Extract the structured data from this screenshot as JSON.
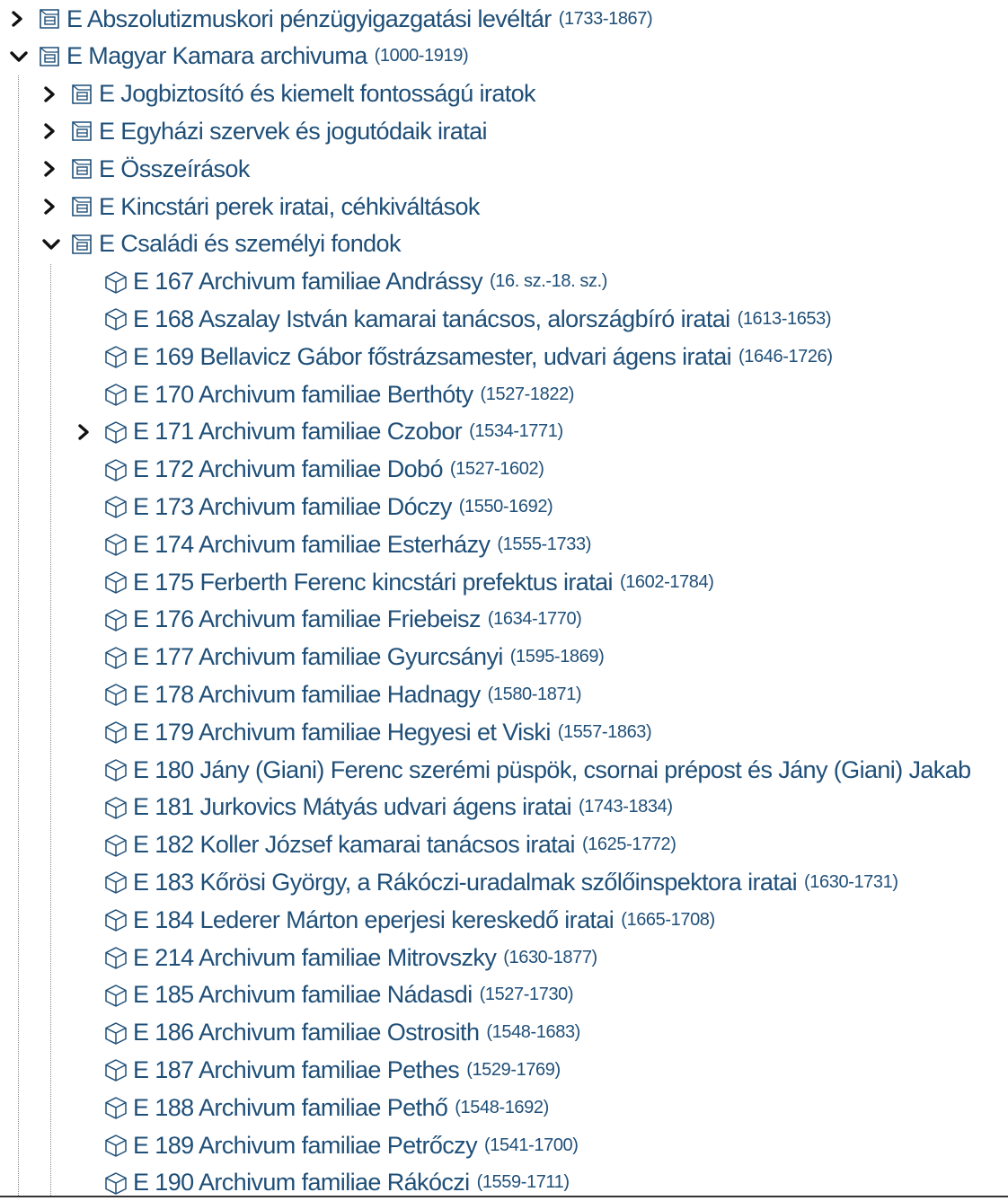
{
  "tree": {
    "level0": [
      {
        "name": "E Abszolutizmuskori pénzügyigazgatási levéltár",
        "years": "(1733-1867)",
        "expander": "chevron-right"
      },
      {
        "name": "E Magyar Kamara archivuma",
        "years": "(1000-1919)",
        "expander": "chevron-down"
      }
    ],
    "level1": [
      {
        "name": "E Jogbiztosító és kiemelt fontosságú iratok",
        "years": "",
        "expander": "chevron-right"
      },
      {
        "name": "E Egyházi szervek és jogutódaik iratai",
        "years": "",
        "expander": "chevron-right"
      },
      {
        "name": "E Összeírások",
        "years": "",
        "expander": "chevron-right"
      },
      {
        "name": "E Kincstári perek iratai, céhkiváltások",
        "years": "",
        "expander": "chevron-right"
      },
      {
        "name": "E Családi és személyi fondok",
        "years": "",
        "expander": "chevron-down"
      }
    ],
    "level2": [
      {
        "name": "E 167 Archivum familiae Andrássy",
        "years": "(16. sz.-18. sz.)",
        "expander": ""
      },
      {
        "name": "E 168 Aszalay István kamarai tanácsos, alországbíró iratai",
        "years": "(1613-1653)",
        "expander": ""
      },
      {
        "name": "E 169 Bellavicz Gábor főstrázsamester, udvari ágens iratai",
        "years": "(1646-1726)",
        "expander": ""
      },
      {
        "name": "E 170 Archivum familiae Berthóty",
        "years": "(1527-1822)",
        "expander": ""
      },
      {
        "name": "E 171 Archivum familiae Czobor",
        "years": "(1534-1771)",
        "expander": "chevron-right"
      },
      {
        "name": "E 172 Archivum familiae Dobó",
        "years": "(1527-1602)",
        "expander": ""
      },
      {
        "name": "E 173 Archivum familiae Dóczy",
        "years": "(1550-1692)",
        "expander": ""
      },
      {
        "name": "E 174 Archivum familiae Esterházy",
        "years": "(1555-1733)",
        "expander": ""
      },
      {
        "name": "E 175 Ferberth Ferenc kincstári prefektus iratai",
        "years": "(1602-1784)",
        "expander": ""
      },
      {
        "name": "E 176 Archivum familiae Friebeisz",
        "years": "(1634-1770)",
        "expander": ""
      },
      {
        "name": "E 177 Archivum familiae Gyurcsányi",
        "years": "(1595-1869)",
        "expander": ""
      },
      {
        "name": "E 178 Archivum familiae Hadnagy",
        "years": "(1580-1871)",
        "expander": ""
      },
      {
        "name": "E 179 Archivum familiae Hegyesi et Viski",
        "years": "(1557-1863)",
        "expander": ""
      },
      {
        "name": "E 180 Jány (Giani) Ferenc szerémi püspök, csornai prépost és Jány (Giani) Jakab",
        "years": "",
        "expander": ""
      },
      {
        "name": "E 181 Jurkovics Mátyás udvari ágens iratai",
        "years": "(1743-1834)",
        "expander": ""
      },
      {
        "name": "E 182 Koller József kamarai tanácsos iratai",
        "years": "(1625-1772)",
        "expander": ""
      },
      {
        "name": "E 183 Kőrösi György, a Rákóczi-uradalmak szőlőinspektora iratai",
        "years": "(1630-1731)",
        "expander": ""
      },
      {
        "name": "E 184 Lederer Márton eperjesi kereskedő iratai",
        "years": "(1665-1708)",
        "expander": ""
      },
      {
        "name": "E 214 Archivum familiae Mitrovszky",
        "years": "(1630-1877)",
        "expander": ""
      },
      {
        "name": "E 185 Archivum familiae Nádasdi",
        "years": "(1527-1730)",
        "expander": ""
      },
      {
        "name": "E 186 Archivum familiae Ostrosith",
        "years": "(1548-1683)",
        "expander": ""
      },
      {
        "name": "E 187 Archivum familiae Pethes",
        "years": "(1529-1769)",
        "expander": ""
      },
      {
        "name": "E 188 Archivum familiae Pethő",
        "years": "(1548-1692)",
        "expander": ""
      },
      {
        "name": "E 189 Archivum familiae Petrőczy",
        "years": "(1541-1700)",
        "expander": ""
      },
      {
        "name": "E 190 Archivum familiae Rákóczi",
        "years": "(1559-1711)",
        "expander": ""
      }
    ]
  },
  "colors": {
    "text": "#1f4f78",
    "icon": "#1f4f78",
    "guide_line": "#8a8a8a"
  },
  "icons": {
    "folder_node": "fonds-group-icon",
    "leaf_node": "cube-icon"
  }
}
